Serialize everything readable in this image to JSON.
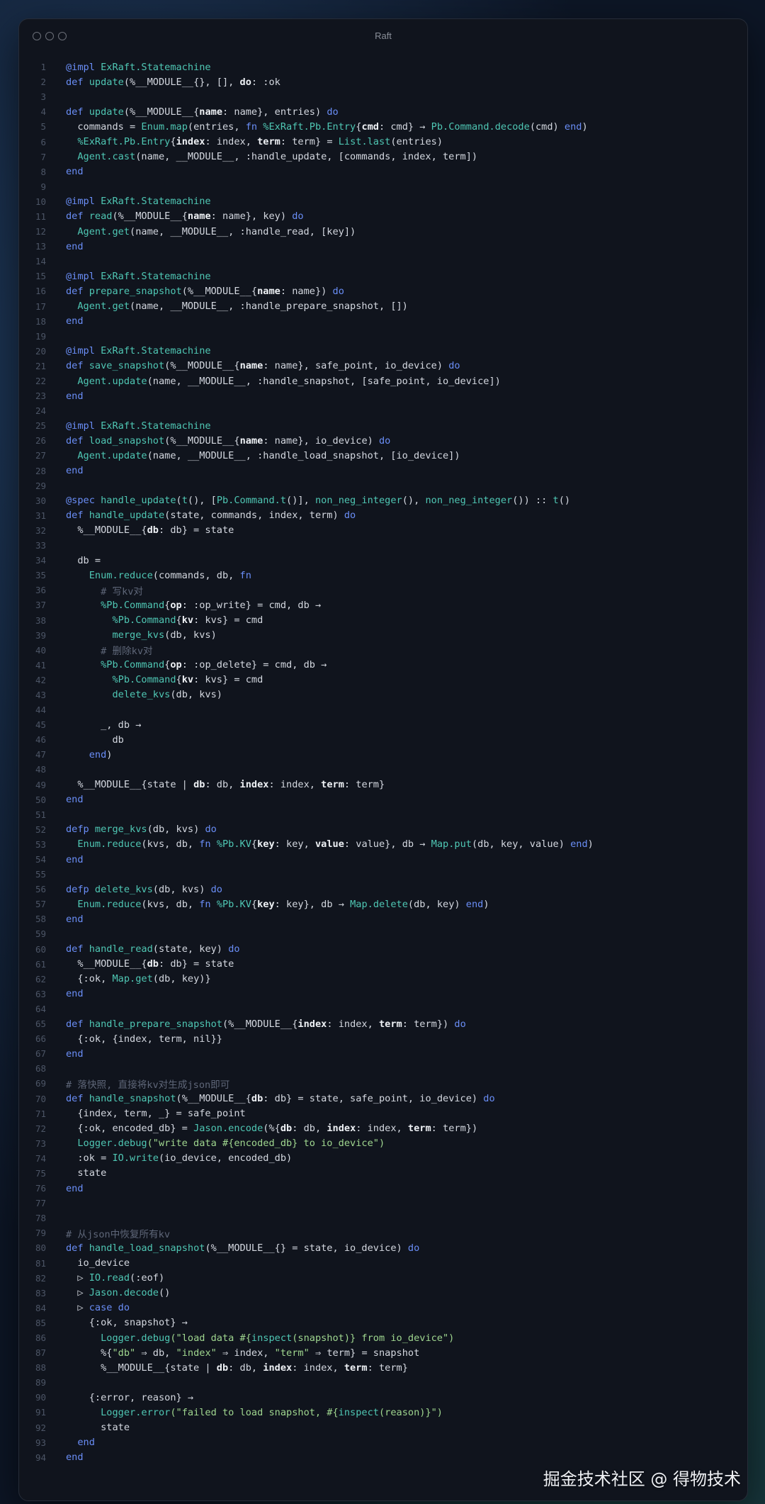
{
  "window": {
    "title": "Raft"
  },
  "watermark": "掘金技术社区 @ 得物技术",
  "code": {
    "language": "elixir",
    "lines": [
      [
        [
          "kw",
          "@impl "
        ],
        [
          "ty",
          "ExRaft.Statemachine"
        ]
      ],
      [
        [
          "kw",
          "def "
        ],
        [
          "ty",
          "update"
        ],
        [
          "tx",
          "(%__MODULE__{}, [], "
        ],
        [
          "bd",
          "do"
        ],
        [
          "tx",
          ": :ok"
        ]
      ],
      [],
      [
        [
          "kw",
          "def "
        ],
        [
          "ty",
          "update"
        ],
        [
          "tx",
          "(%__MODULE__{"
        ],
        [
          "bd",
          "name"
        ],
        [
          "tx",
          ": name}, entries) "
        ],
        [
          "kw",
          "do"
        ]
      ],
      [
        [
          "tx",
          "  commands = "
        ],
        [
          "ty",
          "Enum.map"
        ],
        [
          "tx",
          "(entries, "
        ],
        [
          "kw",
          "fn "
        ],
        [
          "ty",
          "%ExRaft.Pb.Entry"
        ],
        [
          "tx",
          "{"
        ],
        [
          "bd",
          "cmd"
        ],
        [
          "tx",
          ": cmd} → "
        ],
        [
          "ty",
          "Pb.Command.decode"
        ],
        [
          "tx",
          "(cmd) "
        ],
        [
          "kw",
          "end"
        ],
        [
          "tx",
          ")"
        ]
      ],
      [
        [
          "ty",
          "  %ExRaft.Pb.Entry"
        ],
        [
          "tx",
          "{"
        ],
        [
          "bd",
          "index"
        ],
        [
          "tx",
          ": index, "
        ],
        [
          "bd",
          "term"
        ],
        [
          "tx",
          ": term} = "
        ],
        [
          "ty",
          "List.last"
        ],
        [
          "tx",
          "(entries)"
        ]
      ],
      [
        [
          "ty",
          "  Agent.cast"
        ],
        [
          "tx",
          "(name, __MODULE__, :handle_update, [commands, index, term])"
        ]
      ],
      [
        [
          "kw",
          "end"
        ]
      ],
      [],
      [
        [
          "kw",
          "@impl "
        ],
        [
          "ty",
          "ExRaft.Statemachine"
        ]
      ],
      [
        [
          "kw",
          "def "
        ],
        [
          "ty",
          "read"
        ],
        [
          "tx",
          "(%__MODULE__{"
        ],
        [
          "bd",
          "name"
        ],
        [
          "tx",
          ": name}, key) "
        ],
        [
          "kw",
          "do"
        ]
      ],
      [
        [
          "ty",
          "  Agent.get"
        ],
        [
          "tx",
          "(name, __MODULE__, :handle_read, [key])"
        ]
      ],
      [
        [
          "kw",
          "end"
        ]
      ],
      [],
      [
        [
          "kw",
          "@impl "
        ],
        [
          "ty",
          "ExRaft.Statemachine"
        ]
      ],
      [
        [
          "kw",
          "def "
        ],
        [
          "ty",
          "prepare_snapshot"
        ],
        [
          "tx",
          "(%__MODULE__{"
        ],
        [
          "bd",
          "name"
        ],
        [
          "tx",
          ": name}) "
        ],
        [
          "kw",
          "do"
        ]
      ],
      [
        [
          "ty",
          "  Agent.get"
        ],
        [
          "tx",
          "(name, __MODULE__, :handle_prepare_snapshot, [])"
        ]
      ],
      [
        [
          "kw",
          "end"
        ]
      ],
      [],
      [
        [
          "kw",
          "@impl "
        ],
        [
          "ty",
          "ExRaft.Statemachine"
        ]
      ],
      [
        [
          "kw",
          "def "
        ],
        [
          "ty",
          "save_snapshot"
        ],
        [
          "tx",
          "(%__MODULE__{"
        ],
        [
          "bd",
          "name"
        ],
        [
          "tx",
          ": name}, safe_point, io_device) "
        ],
        [
          "kw",
          "do"
        ]
      ],
      [
        [
          "ty",
          "  Agent.update"
        ],
        [
          "tx",
          "(name, __MODULE__, :handle_snapshot, [safe_point, io_device])"
        ]
      ],
      [
        [
          "kw",
          "end"
        ]
      ],
      [],
      [
        [
          "kw",
          "@impl "
        ],
        [
          "ty",
          "ExRaft.Statemachine"
        ]
      ],
      [
        [
          "kw",
          "def "
        ],
        [
          "ty",
          "load_snapshot"
        ],
        [
          "tx",
          "(%__MODULE__{"
        ],
        [
          "bd",
          "name"
        ],
        [
          "tx",
          ": name}, io_device) "
        ],
        [
          "kw",
          "do"
        ]
      ],
      [
        [
          "ty",
          "  Agent.update"
        ],
        [
          "tx",
          "(name, __MODULE__, :handle_load_snapshot, [io_device])"
        ]
      ],
      [
        [
          "kw",
          "end"
        ]
      ],
      [],
      [
        [
          "kw",
          "@spec "
        ],
        [
          "ty",
          "handle_update"
        ],
        [
          "tx",
          "("
        ],
        [
          "ty",
          "t"
        ],
        [
          "tx",
          "(), ["
        ],
        [
          "ty",
          "Pb.Command.t"
        ],
        [
          "tx",
          "()], "
        ],
        [
          "ty",
          "non_neg_integer"
        ],
        [
          "tx",
          "(), "
        ],
        [
          "ty",
          "non_neg_integer"
        ],
        [
          "tx",
          "()) :: "
        ],
        [
          "ty",
          "t"
        ],
        [
          "tx",
          "()"
        ]
      ],
      [
        [
          "kw",
          "def "
        ],
        [
          "ty",
          "handle_update"
        ],
        [
          "tx",
          "(state, commands, index, term) "
        ],
        [
          "kw",
          "do"
        ]
      ],
      [
        [
          "tx",
          "  %__MODULE__{"
        ],
        [
          "bd",
          "db"
        ],
        [
          "tx",
          ": db} = state"
        ]
      ],
      [],
      [
        [
          "tx",
          "  db ="
        ]
      ],
      [
        [
          "ty",
          "    Enum.reduce"
        ],
        [
          "tx",
          "(commands, db, "
        ],
        [
          "kw",
          "fn"
        ]
      ],
      [
        [
          "cm",
          "      # 写kv对"
        ]
      ],
      [
        [
          "ty",
          "      %Pb.Command"
        ],
        [
          "tx",
          "{"
        ],
        [
          "bd",
          "op"
        ],
        [
          "tx",
          ": :op_write} = cmd, db →"
        ]
      ],
      [
        [
          "ty",
          "        %Pb.Command"
        ],
        [
          "tx",
          "{"
        ],
        [
          "bd",
          "kv"
        ],
        [
          "tx",
          ": kvs} = cmd"
        ]
      ],
      [
        [
          "ty",
          "        merge_kvs"
        ],
        [
          "tx",
          "(db, kvs)"
        ]
      ],
      [
        [
          "cm",
          "      # 删除kv对"
        ]
      ],
      [
        [
          "ty",
          "      %Pb.Command"
        ],
        [
          "tx",
          "{"
        ],
        [
          "bd",
          "op"
        ],
        [
          "tx",
          ": :op_delete} = cmd, db →"
        ]
      ],
      [
        [
          "ty",
          "        %Pb.Command"
        ],
        [
          "tx",
          "{"
        ],
        [
          "bd",
          "kv"
        ],
        [
          "tx",
          ": kvs} = cmd"
        ]
      ],
      [
        [
          "ty",
          "        delete_kvs"
        ],
        [
          "tx",
          "(db, kvs)"
        ]
      ],
      [],
      [
        [
          "tx",
          "      _, db →"
        ]
      ],
      [
        [
          "tx",
          "        db"
        ]
      ],
      [
        [
          "kw",
          "    end"
        ],
        [
          "tx",
          ")"
        ]
      ],
      [],
      [
        [
          "tx",
          "  %__MODULE__{state | "
        ],
        [
          "bd",
          "db"
        ],
        [
          "tx",
          ": db, "
        ],
        [
          "bd",
          "index"
        ],
        [
          "tx",
          ": index, "
        ],
        [
          "bd",
          "term"
        ],
        [
          "tx",
          ": term}"
        ]
      ],
      [
        [
          "kw",
          "end"
        ]
      ],
      [],
      [
        [
          "kw",
          "defp "
        ],
        [
          "ty",
          "merge_kvs"
        ],
        [
          "tx",
          "(db, kvs) "
        ],
        [
          "kw",
          "do"
        ]
      ],
      [
        [
          "ty",
          "  Enum.reduce"
        ],
        [
          "tx",
          "(kvs, db, "
        ],
        [
          "kw",
          "fn "
        ],
        [
          "ty",
          "%Pb.KV"
        ],
        [
          "tx",
          "{"
        ],
        [
          "bd",
          "key"
        ],
        [
          "tx",
          ": key, "
        ],
        [
          "bd",
          "value"
        ],
        [
          "tx",
          ": value}, db → "
        ],
        [
          "ty",
          "Map.put"
        ],
        [
          "tx",
          "(db, key, value) "
        ],
        [
          "kw",
          "end"
        ],
        [
          "tx",
          ")"
        ]
      ],
      [
        [
          "kw",
          "end"
        ]
      ],
      [],
      [
        [
          "kw",
          "defp "
        ],
        [
          "ty",
          "delete_kvs"
        ],
        [
          "tx",
          "(db, kvs) "
        ],
        [
          "kw",
          "do"
        ]
      ],
      [
        [
          "ty",
          "  Enum.reduce"
        ],
        [
          "tx",
          "(kvs, db, "
        ],
        [
          "kw",
          "fn "
        ],
        [
          "ty",
          "%Pb.KV"
        ],
        [
          "tx",
          "{"
        ],
        [
          "bd",
          "key"
        ],
        [
          "tx",
          ": key}, db → "
        ],
        [
          "ty",
          "Map.delete"
        ],
        [
          "tx",
          "(db, key) "
        ],
        [
          "kw",
          "end"
        ],
        [
          "tx",
          ")"
        ]
      ],
      [
        [
          "kw",
          "end"
        ]
      ],
      [],
      [
        [
          "kw",
          "def "
        ],
        [
          "ty",
          "handle_read"
        ],
        [
          "tx",
          "(state, key) "
        ],
        [
          "kw",
          "do"
        ]
      ],
      [
        [
          "tx",
          "  %__MODULE__{"
        ],
        [
          "bd",
          "db"
        ],
        [
          "tx",
          ": db} = state"
        ]
      ],
      [
        [
          "tx",
          "  {:ok, "
        ],
        [
          "ty",
          "Map.get"
        ],
        [
          "tx",
          "(db, key)}"
        ]
      ],
      [
        [
          "kw",
          "end"
        ]
      ],
      [],
      [
        [
          "kw",
          "def "
        ],
        [
          "ty",
          "handle_prepare_snapshot"
        ],
        [
          "tx",
          "(%__MODULE__{"
        ],
        [
          "bd",
          "index"
        ],
        [
          "tx",
          ": index, "
        ],
        [
          "bd",
          "term"
        ],
        [
          "tx",
          ": term}) "
        ],
        [
          "kw",
          "do"
        ]
      ],
      [
        [
          "tx",
          "  {:ok, {index, term, nil}}"
        ]
      ],
      [
        [
          "kw",
          "end"
        ]
      ],
      [],
      [
        [
          "cm",
          "# 落快照, 直接将kv对生成json即可"
        ]
      ],
      [
        [
          "kw",
          "def "
        ],
        [
          "ty",
          "handle_snapshot"
        ],
        [
          "tx",
          "(%__MODULE__{"
        ],
        [
          "bd",
          "db"
        ],
        [
          "tx",
          ": db} = state, safe_point, io_device) "
        ],
        [
          "kw",
          "do"
        ]
      ],
      [
        [
          "tx",
          "  {index, term, _} = safe_point"
        ]
      ],
      [
        [
          "tx",
          "  {:ok, encoded_db} = "
        ],
        [
          "ty",
          "Jason.encode"
        ],
        [
          "tx",
          "(%{"
        ],
        [
          "bd",
          "db"
        ],
        [
          "tx",
          ": db, "
        ],
        [
          "bd",
          "index"
        ],
        [
          "tx",
          ": index, "
        ],
        [
          "bd",
          "term"
        ],
        [
          "tx",
          ": term})"
        ]
      ],
      [
        [
          "ty",
          "  Logger.debug"
        ],
        [
          "st",
          "(\"write data #{encoded_db} to io_device\")"
        ]
      ],
      [
        [
          "tx",
          "  :ok = "
        ],
        [
          "ty",
          "IO.write"
        ],
        [
          "tx",
          "(io_device, encoded_db)"
        ]
      ],
      [
        [
          "tx",
          "  state"
        ]
      ],
      [
        [
          "kw",
          "end"
        ]
      ],
      [],
      [],
      [
        [
          "cm",
          "# 从json中恢复所有kv"
        ]
      ],
      [
        [
          "kw",
          "def "
        ],
        [
          "ty",
          "handle_load_snapshot"
        ],
        [
          "tx",
          "(%__MODULE__{} = state, io_device) "
        ],
        [
          "kw",
          "do"
        ]
      ],
      [
        [
          "tx",
          "  io_device"
        ]
      ],
      [
        [
          "tx",
          "  ▷ "
        ],
        [
          "ty",
          "IO.read"
        ],
        [
          "tx",
          "(:eof)"
        ]
      ],
      [
        [
          "tx",
          "  ▷ "
        ],
        [
          "ty",
          "Jason.decode"
        ],
        [
          "tx",
          "()"
        ]
      ],
      [
        [
          "tx",
          "  ▷ "
        ],
        [
          "kw",
          "case do"
        ]
      ],
      [
        [
          "tx",
          "    {:ok, snapshot} →"
        ]
      ],
      [
        [
          "ty",
          "      Logger.debug"
        ],
        [
          "st",
          "(\"load data #{"
        ],
        [
          "ty",
          "inspect"
        ],
        [
          "st",
          "(snapshot)} from io_device\")"
        ]
      ],
      [
        [
          "tx",
          "      %{"
        ],
        [
          "st",
          "\"db\""
        ],
        [
          "tx",
          " ⇒ db, "
        ],
        [
          "st",
          "\"index\""
        ],
        [
          "tx",
          " ⇒ index, "
        ],
        [
          "st",
          "\"term\""
        ],
        [
          "tx",
          " ⇒ term} = snapshot"
        ]
      ],
      [
        [
          "tx",
          "      %__MODULE__{state | "
        ],
        [
          "bd",
          "db"
        ],
        [
          "tx",
          ": db, "
        ],
        [
          "bd",
          "index"
        ],
        [
          "tx",
          ": index, "
        ],
        [
          "bd",
          "term"
        ],
        [
          "tx",
          ": term}"
        ]
      ],
      [],
      [
        [
          "tx",
          "    {:error, reason} →"
        ]
      ],
      [
        [
          "ty",
          "      Logger.error"
        ],
        [
          "st",
          "(\"failed to load snapshot, #{"
        ],
        [
          "ty",
          "inspect"
        ],
        [
          "st",
          "(reason)}\")"
        ]
      ],
      [
        [
          "tx",
          "      state"
        ]
      ],
      [
        [
          "kw",
          "  end"
        ]
      ],
      [
        [
          "kw",
          "end"
        ]
      ]
    ]
  }
}
